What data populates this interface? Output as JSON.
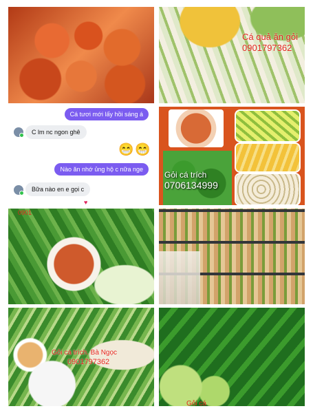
{
  "panel_top_right": {
    "lines": [
      "Cá quả ăn gỏi",
      "0901797362"
    ]
  },
  "chat": {
    "msg_out_1": "Cá tươi mới lấy hồi sáng á",
    "msg_in_1": "C lm nc ngon ghê",
    "emoji": [
      "😁",
      "😁"
    ],
    "msg_out_2": "Nào ăn nhớ ủng hộ c nữa nge",
    "msg_in_2": "Bữa nào en e gọi c",
    "heart": "♥"
  },
  "panel_mid_right": {
    "title": "Gỏi cá trích",
    "phone": "0706134999"
  },
  "panel_left_3": {
    "tag": "0901"
  },
  "panel_bottom_left": {
    "line1": "Gỏi cá trích. Bà Ngọc",
    "line2": "0901797362"
  },
  "panel_bottom_right": {
    "line1": "Gỏi cá"
  }
}
